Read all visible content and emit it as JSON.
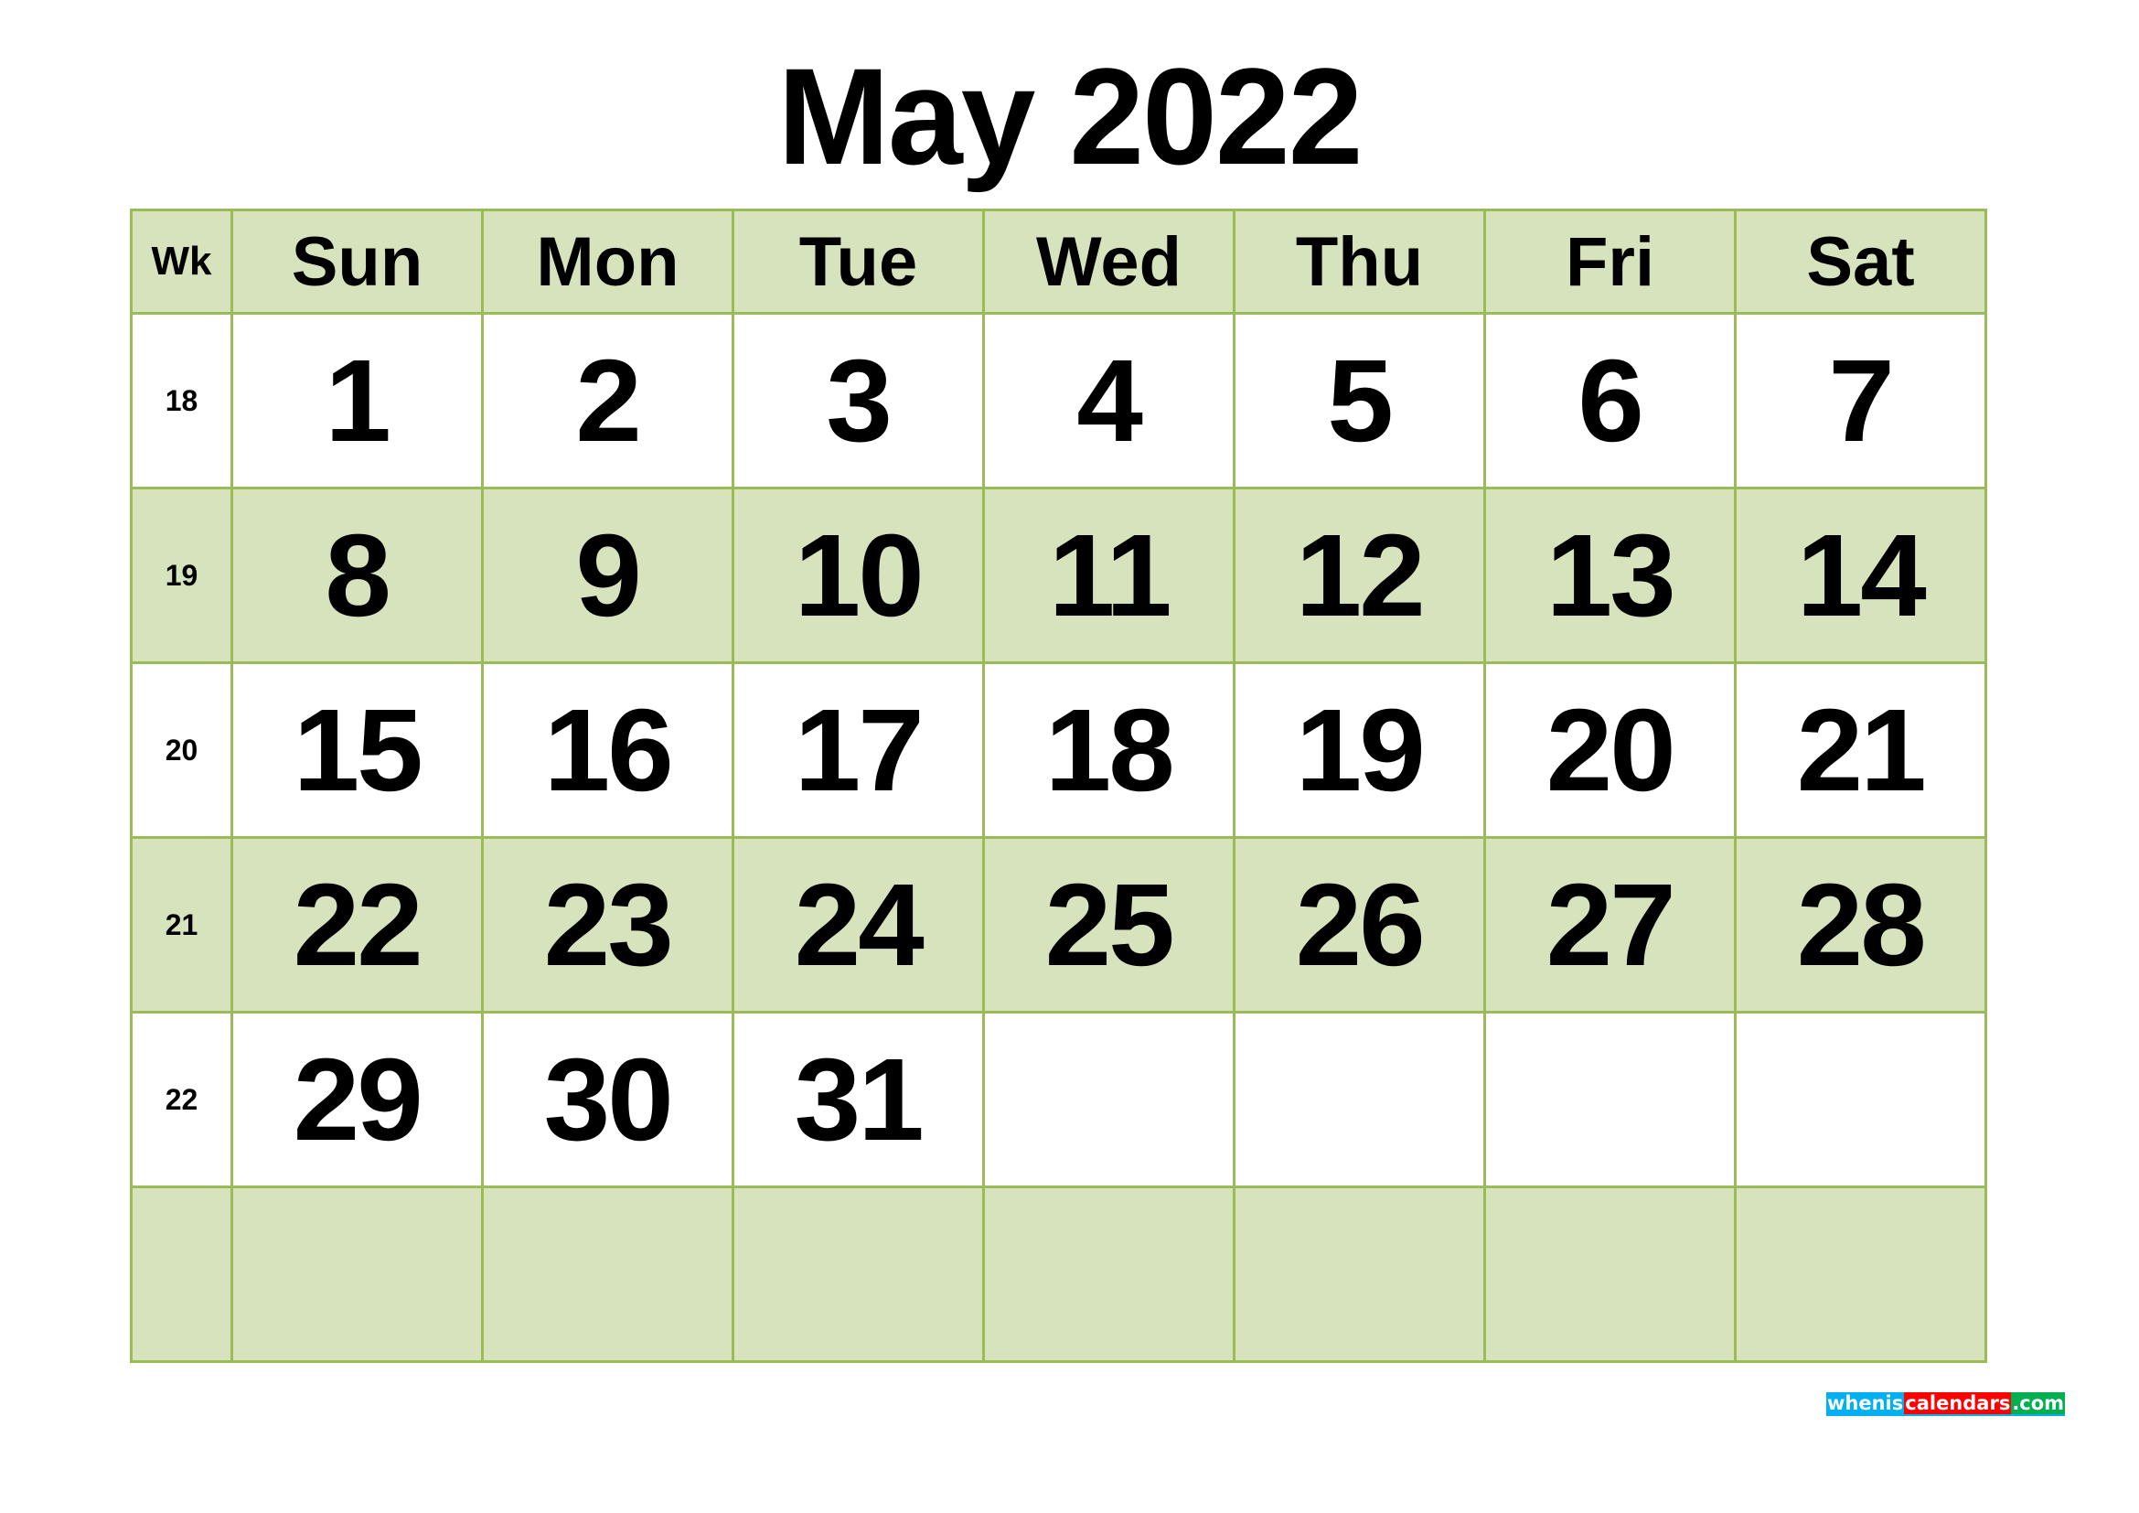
{
  "title": "May 2022",
  "header": {
    "week_label": "Wk",
    "days": [
      "Sun",
      "Mon",
      "Tue",
      "Wed",
      "Thu",
      "Fri",
      "Sat"
    ]
  },
  "weeks": [
    {
      "wk": "18",
      "days": [
        "1",
        "2",
        "3",
        "4",
        "5",
        "6",
        "7"
      ]
    },
    {
      "wk": "19",
      "days": [
        "8",
        "9",
        "10",
        "11",
        "12",
        "13",
        "14"
      ]
    },
    {
      "wk": "20",
      "days": [
        "15",
        "16",
        "17",
        "18",
        "19",
        "20",
        "21"
      ]
    },
    {
      "wk": "21",
      "days": [
        "22",
        "23",
        "24",
        "25",
        "26",
        "27",
        "28"
      ]
    },
    {
      "wk": "22",
      "days": [
        "29",
        "30",
        "31",
        "",
        "",
        "",
        ""
      ]
    },
    {
      "wk": "",
      "days": [
        "",
        "",
        "",
        "",
        "",
        "",
        ""
      ]
    }
  ],
  "colors": {
    "border": "#9bbb59",
    "shade": "#d7e3bc",
    "logo_blue": "#00b0f0",
    "logo_red": "#ff0000",
    "logo_green": "#00b050"
  },
  "watermark": {
    "part1": "whenis",
    "part2": "calendars",
    "part3": ".com"
  }
}
